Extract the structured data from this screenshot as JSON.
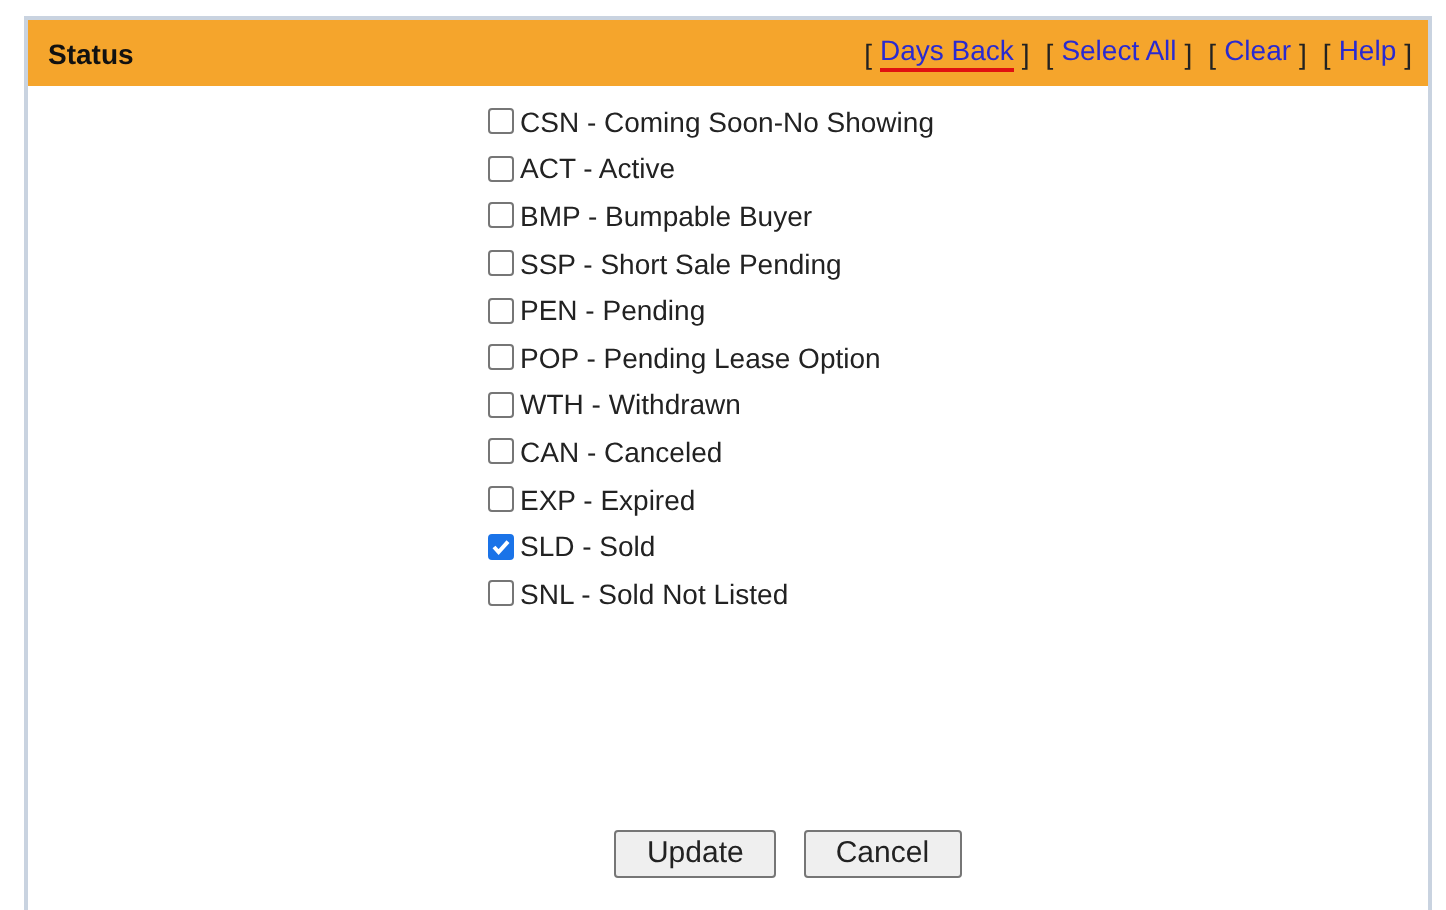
{
  "panel": {
    "title": "Status"
  },
  "header_links": [
    {
      "open": "[",
      "label": "Days Back",
      "close": "]",
      "highlighted": true
    },
    {
      "open": "[",
      "label": "Select All",
      "close": "]",
      "highlighted": false
    },
    {
      "open": "[",
      "label": "Clear",
      "close": "]",
      "highlighted": false
    },
    {
      "open": "[",
      "label": "Help",
      "close": "]",
      "highlighted": false
    }
  ],
  "statuses": [
    {
      "label": "CSN - Coming Soon-No Showing",
      "checked": false
    },
    {
      "label": "ACT - Active",
      "checked": false
    },
    {
      "label": "BMP - Bumpable Buyer",
      "checked": false
    },
    {
      "label": "SSP - Short Sale Pending",
      "checked": false
    },
    {
      "label": "PEN - Pending",
      "checked": false
    },
    {
      "label": "POP - Pending Lease Option",
      "checked": false
    },
    {
      "label": "WTH - Withdrawn",
      "checked": false
    },
    {
      "label": "CAN - Canceled",
      "checked": false
    },
    {
      "label": "EXP - Expired",
      "checked": false
    },
    {
      "label": "SLD - Sold",
      "checked": true
    },
    {
      "label": "SNL - Sold Not Listed",
      "checked": false
    }
  ],
  "buttons": [
    "Update",
    "Cancel"
  ]
}
